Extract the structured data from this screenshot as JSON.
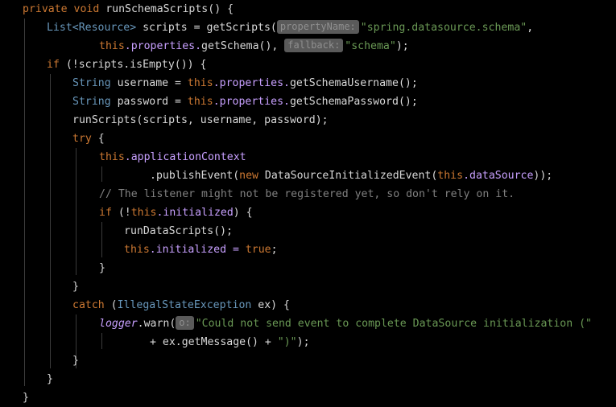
{
  "colors": {
    "background": "#000000",
    "keyword": "#cc7832",
    "type": "#6897bb",
    "text": "#d8d8d8",
    "field": "#c8a0ff",
    "string": "#6a9955",
    "comment": "#808080",
    "hint_bg": "#5a5a5a"
  },
  "code_lines": [
    [
      {
        "t": "private void ",
        "c": "kw"
      },
      {
        "t": "runSchemaScripts() {",
        "c": "plain"
      }
    ],
    [
      {
        "t": "List",
        "c": "type"
      },
      {
        "t": "<Resource> ",
        "c": "type"
      },
      {
        "t": "scripts = getScripts(",
        "c": "plain"
      },
      {
        "t": "propertyName:",
        "c": "hint"
      },
      {
        "t": "\"spring.datasource.schema\"",
        "c": "str"
      },
      {
        "t": ",",
        "c": "plain"
      }
    ],
    [
      {
        "t": "this",
        "c": "kw"
      },
      {
        "t": ".properties.",
        "c": "field"
      },
      {
        "t": "getSchema(), ",
        "c": "plain"
      },
      {
        "t": "fallback:",
        "c": "hint"
      },
      {
        "t": "\"schema\"",
        "c": "str"
      },
      {
        "t": ");",
        "c": "plain"
      }
    ],
    [
      {
        "t": "if ",
        "c": "kw"
      },
      {
        "t": "(!scripts.isEmpty()) {",
        "c": "plain"
      }
    ],
    [
      {
        "t": "String ",
        "c": "type"
      },
      {
        "t": "username = ",
        "c": "plain"
      },
      {
        "t": "this",
        "c": "kw"
      },
      {
        "t": ".properties.",
        "c": "field"
      },
      {
        "t": "getSchemaUsername();",
        "c": "plain"
      }
    ],
    [
      {
        "t": "String ",
        "c": "type"
      },
      {
        "t": "password = ",
        "c": "plain"
      },
      {
        "t": "this",
        "c": "kw"
      },
      {
        "t": ".properties.",
        "c": "field"
      },
      {
        "t": "getSchemaPassword();",
        "c": "plain"
      }
    ],
    [
      {
        "t": "runScripts(scripts, username, password);",
        "c": "plain"
      }
    ],
    [
      {
        "t": "try ",
        "c": "kw"
      },
      {
        "t": "{",
        "c": "plain"
      }
    ],
    [
      {
        "t": "this",
        "c": "kw"
      },
      {
        "t": ".applicationContext",
        "c": "field"
      }
    ],
    [
      {
        "t": ".publishEvent(",
        "c": "plain"
      },
      {
        "t": "new ",
        "c": "kw"
      },
      {
        "t": "DataSourceInitializedEvent(",
        "c": "plain"
      },
      {
        "t": "this",
        "c": "kw"
      },
      {
        "t": ".dataSource",
        "c": "field"
      },
      {
        "t": "));",
        "c": "plain"
      }
    ],
    [
      {
        "t": "// The listener might not be registered yet, so don't rely on it.",
        "c": "comment"
      }
    ],
    [
      {
        "t": "if ",
        "c": "kw"
      },
      {
        "t": "(!",
        "c": "plain"
      },
      {
        "t": "this",
        "c": "kw"
      },
      {
        "t": ".initialized",
        "c": "field"
      },
      {
        "t": ") {",
        "c": "plain"
      }
    ],
    [
      {
        "t": "runDataScripts();",
        "c": "plain"
      }
    ],
    [
      {
        "t": "this",
        "c": "kw"
      },
      {
        "t": ".initialized = ",
        "c": "field"
      },
      {
        "t": "true",
        "c": "kw"
      },
      {
        "t": ";",
        "c": "plain"
      }
    ],
    [
      {
        "t": "}",
        "c": "plain"
      }
    ],
    [
      {
        "t": "}",
        "c": "plain"
      }
    ],
    [
      {
        "t": "catch ",
        "c": "kw"
      },
      {
        "t": "(",
        "c": "plain"
      },
      {
        "t": "IllegalStateException ",
        "c": "type"
      },
      {
        "t": "ex) {",
        "c": "plain"
      }
    ],
    [
      {
        "t": "logger",
        "c": "field-italic"
      },
      {
        "t": ".warn(",
        "c": "plain"
      },
      {
        "t": "o:",
        "c": "hint"
      },
      {
        "t": "\"Could not send event to complete DataSource initialization (\"",
        "c": "str"
      }
    ],
    [
      {
        "t": "+ ex.",
        "c": "plain"
      },
      {
        "t": "getMessage() + ",
        "c": "plain"
      },
      {
        "t": "\")\"",
        "c": "str"
      },
      {
        "t": ");",
        "c": "plain"
      }
    ],
    [
      {
        "t": "}",
        "c": "plain"
      }
    ],
    [
      {
        "t": "}",
        "c": "plain"
      }
    ],
    [
      {
        "t": "}",
        "c": "plain"
      }
    ]
  ]
}
